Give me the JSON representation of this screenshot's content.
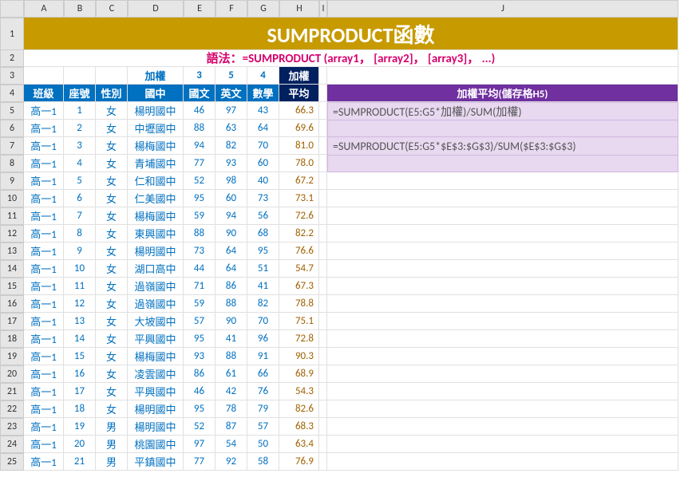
{
  "columns": [
    "A",
    "B",
    "C",
    "D",
    "E",
    "F",
    "G",
    "H",
    "I",
    "J"
  ],
  "row_labels": [
    1,
    2,
    3,
    4,
    5,
    6,
    7,
    8,
    9,
    10,
    11,
    12,
    13,
    14,
    15,
    16,
    17,
    18,
    19,
    20,
    21,
    22,
    23,
    24,
    25
  ],
  "title": "SUMPRODUCT函數",
  "syntax": "語法：=SUMPRODUCT (array1， [array2]， [array3]， ...)",
  "weight_row": {
    "label": "加權",
    "values": [
      3,
      5,
      4
    ],
    "right_label": "加權"
  },
  "header_row": [
    "班級",
    "座號",
    "性別",
    "國中",
    "國文",
    "英文",
    "數學",
    "平均"
  ],
  "formula_header": "加權平均(儲存格H5)",
  "formula1": "=SUMPRODUCT(E5:G5*加權)/SUM(加權)",
  "formula2": "=SUMPRODUCT(E5:G5*$E$3:$G$3)/SUM($E$3:$G$3)",
  "chart_data": {
    "type": "table",
    "columns": [
      "班級",
      "座號",
      "性別",
      "國中",
      "國文",
      "英文",
      "數學",
      "加權平均"
    ],
    "rows": [
      [
        "高一1",
        1,
        "女",
        "楊明國中",
        46,
        97,
        43,
        66.3
      ],
      [
        "高一1",
        2,
        "女",
        "中壢國中",
        88,
        63,
        64,
        69.6
      ],
      [
        "高一1",
        3,
        "女",
        "楊梅國中",
        94,
        82,
        70,
        81.0
      ],
      [
        "高一1",
        4,
        "女",
        "青埔國中",
        77,
        93,
        60,
        78.0
      ],
      [
        "高一1",
        5,
        "女",
        "仁和國中",
        52,
        98,
        40,
        67.2
      ],
      [
        "高一1",
        6,
        "女",
        "仁美國中",
        95,
        60,
        73,
        73.1
      ],
      [
        "高一1",
        7,
        "女",
        "楊梅國中",
        59,
        94,
        56,
        72.6
      ],
      [
        "高一1",
        8,
        "女",
        "東興國中",
        88,
        90,
        68,
        82.2
      ],
      [
        "高一1",
        9,
        "女",
        "楊明國中",
        73,
        64,
        95,
        76.6
      ],
      [
        "高一1",
        10,
        "女",
        "湖口高中",
        44,
        64,
        51,
        54.7
      ],
      [
        "高一1",
        11,
        "女",
        "過嶺國中",
        71,
        86,
        41,
        67.3
      ],
      [
        "高一1",
        12,
        "女",
        "過嶺國中",
        59,
        88,
        82,
        78.8
      ],
      [
        "高一1",
        13,
        "女",
        "大坡國中",
        57,
        90,
        70,
        75.1
      ],
      [
        "高一1",
        14,
        "女",
        "平興國中",
        95,
        41,
        96,
        72.8
      ],
      [
        "高一1",
        15,
        "女",
        "楊梅國中",
        93,
        88,
        91,
        90.3
      ],
      [
        "高一1",
        16,
        "女",
        "凌雲國中",
        86,
        61,
        66,
        68.9
      ],
      [
        "高一1",
        17,
        "女",
        "平興國中",
        46,
        42,
        76,
        54.3
      ],
      [
        "高一1",
        18,
        "女",
        "楊明國中",
        95,
        78,
        79,
        82.6
      ],
      [
        "高一1",
        19,
        "男",
        "楊明國中",
        52,
        87,
        57,
        68.3
      ],
      [
        "高一1",
        20,
        "男",
        "桃園國中",
        97,
        54,
        50,
        63.4
      ],
      [
        "高一1",
        21,
        "男",
        "平鎮國中",
        77,
        92,
        58,
        76.9
      ]
    ]
  }
}
